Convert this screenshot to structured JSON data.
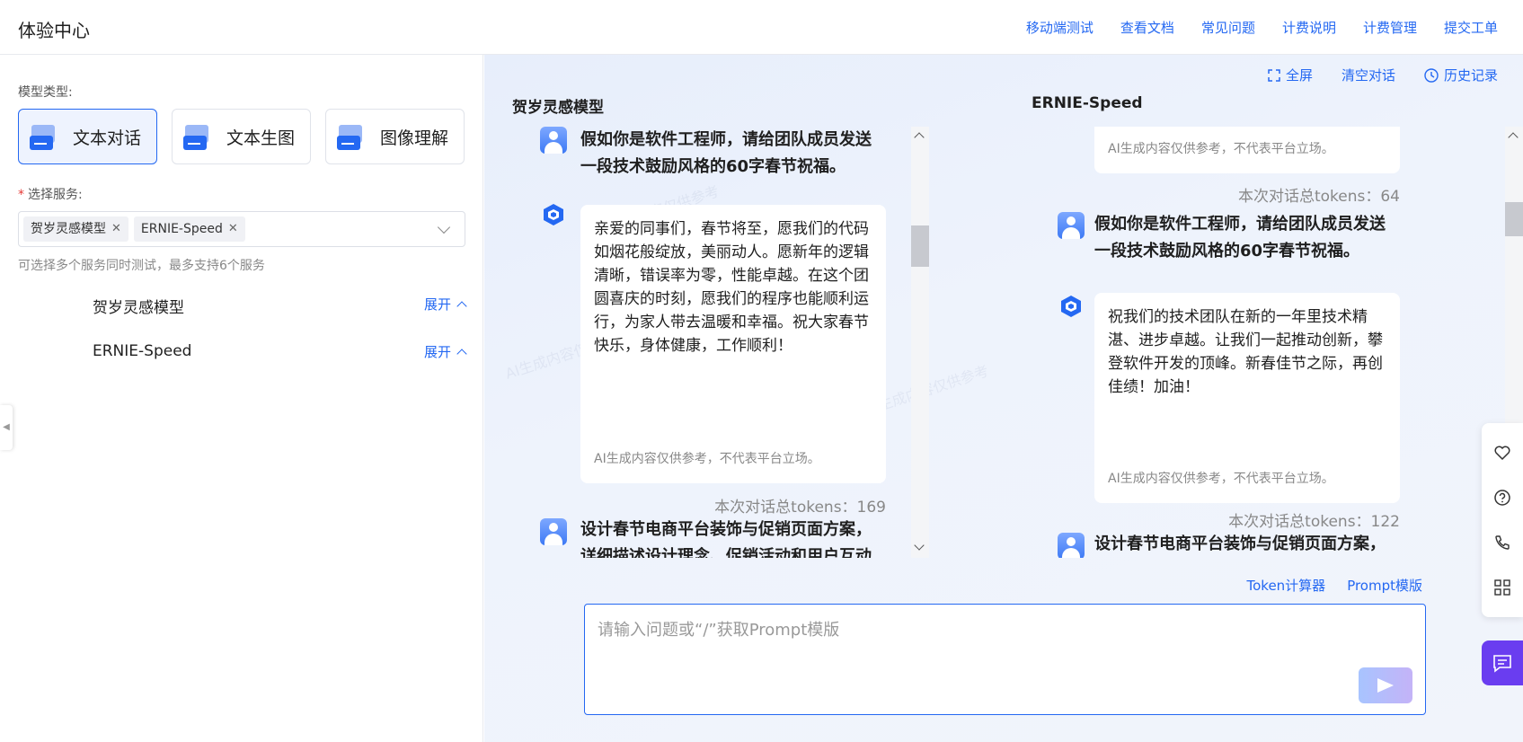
{
  "header": {
    "title": "体验中心",
    "nav": [
      "移动端测试",
      "查看文档",
      "常见问题",
      "计费说明",
      "计费管理",
      "提交工单"
    ]
  },
  "left": {
    "model_type_label": "模型类型:",
    "model_types": [
      {
        "label": "文本对话",
        "icon": "text-chat-icon",
        "active": true
      },
      {
        "label": "文本生图",
        "icon": "text-to-image-icon",
        "active": false
      },
      {
        "label": "图像理解",
        "icon": "image-understanding-icon",
        "active": false
      }
    ],
    "service_label": "选择服务:",
    "selected_services": [
      "贺岁灵感模型",
      "ERNIE-Speed"
    ],
    "hint": "可选择多个服务同时测试，最多支持6个服务",
    "service_rows": [
      {
        "name": "贺岁灵感模型",
        "expand": "展开"
      },
      {
        "name": "ERNIE-Speed",
        "expand": "展开"
      }
    ]
  },
  "toolbar": {
    "fullscreen": "全屏",
    "clear": "清空对话",
    "history": "历史记录"
  },
  "panels": [
    {
      "title": "贺岁灵感模型",
      "question1": "假如你是软件工程师，请给团队成员发送一段技术鼓励风格的60字春节祝福。",
      "answer1": "亲爱的同事们，春节将至，愿我们的代码如烟花般绽放，美丽动人。愿新年的逻辑清晰，错误率为零，性能卓越。在这个团圆喜庆的时刻，愿我们的程序也能顺利运行，为家人带去温暖和幸福。祝大家春节快乐，身体健康，工作顺利！",
      "disclaimer": "AI生成内容仅供参考，不代表平台立场。",
      "tokens": "本次对话总tokens：169",
      "question2": "设计春节电商平台装饰与促销页面方案，详细描述设计理念、促销活动和用户互动元素。"
    },
    {
      "title": "ERNIE-Speed",
      "disclaimer_top": "AI生成内容仅供参考，不代表平台立场。",
      "tokens_top": "本次对话总tokens：64",
      "question1": "假如你是软件工程师，请给团队成员发送一段技术鼓励风格的60字春节祝福。",
      "answer1": "祝我们的技术团队在新的一年里技术精湛、进步卓越。让我们一起推动创新，攀登软件开发的顶峰。新春佳节之际，再创佳绩！加油！",
      "disclaimer": "AI生成内容仅供参考，不代表平台立场。",
      "tokens": "本次对话总tokens：122",
      "question2": "设计春节电商平台装饰与促销页面方案，详细描述设计理念、促销活动和用户互动元素。"
    }
  ],
  "input": {
    "links": [
      "Token计算器",
      "Prompt模版"
    ],
    "placeholder": "请输入问题或“/”获取Prompt模版"
  },
  "watermark": "AI生成内容仅供参考",
  "colors": {
    "accent": "#2468f2",
    "fab": "#6a3df0"
  }
}
